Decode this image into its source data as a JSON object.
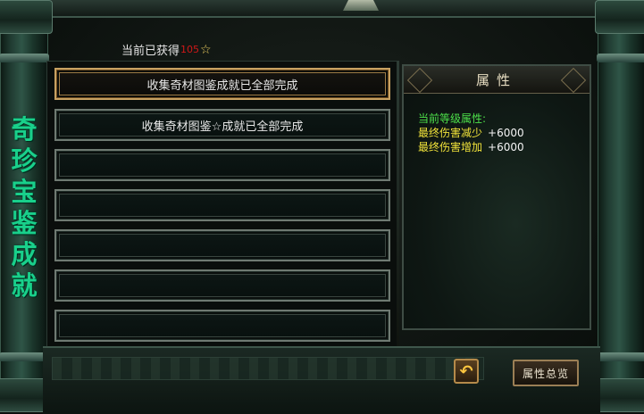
{
  "window": {
    "vertical_title": [
      "奇",
      "珍",
      "宝",
      "鉴",
      "成",
      "就"
    ]
  },
  "header": {
    "obtained_prefix": "当前已获得",
    "obtained_count": "105",
    "star_icon": "☆"
  },
  "achievements": {
    "rows": [
      {
        "label": "收集奇材图鉴成就已全部完成",
        "selected": true
      },
      {
        "label": "收集奇材图鉴☆成就已全部完成",
        "selected": false
      },
      {
        "label": "",
        "selected": false
      },
      {
        "label": "",
        "selected": false
      },
      {
        "label": "",
        "selected": false
      },
      {
        "label": "",
        "selected": false
      },
      {
        "label": "",
        "selected": false
      }
    ]
  },
  "attributes": {
    "title": "属性",
    "current_level_label": "当前等级属性:",
    "lines": [
      {
        "name": "最终伤害减少",
        "value": "+6000"
      },
      {
        "name": "最终伤害增加",
        "value": "+6000"
      }
    ]
  },
  "buttons": {
    "back_icon": "back-arrow-icon",
    "overview_label": "属性总览"
  },
  "colors": {
    "title_green": "#19d08b",
    "attr_header_green": "#4de04a",
    "attr_name_yellow": "#f0e23a",
    "count_red": "#d01818",
    "selected_border": "#c7a162"
  }
}
